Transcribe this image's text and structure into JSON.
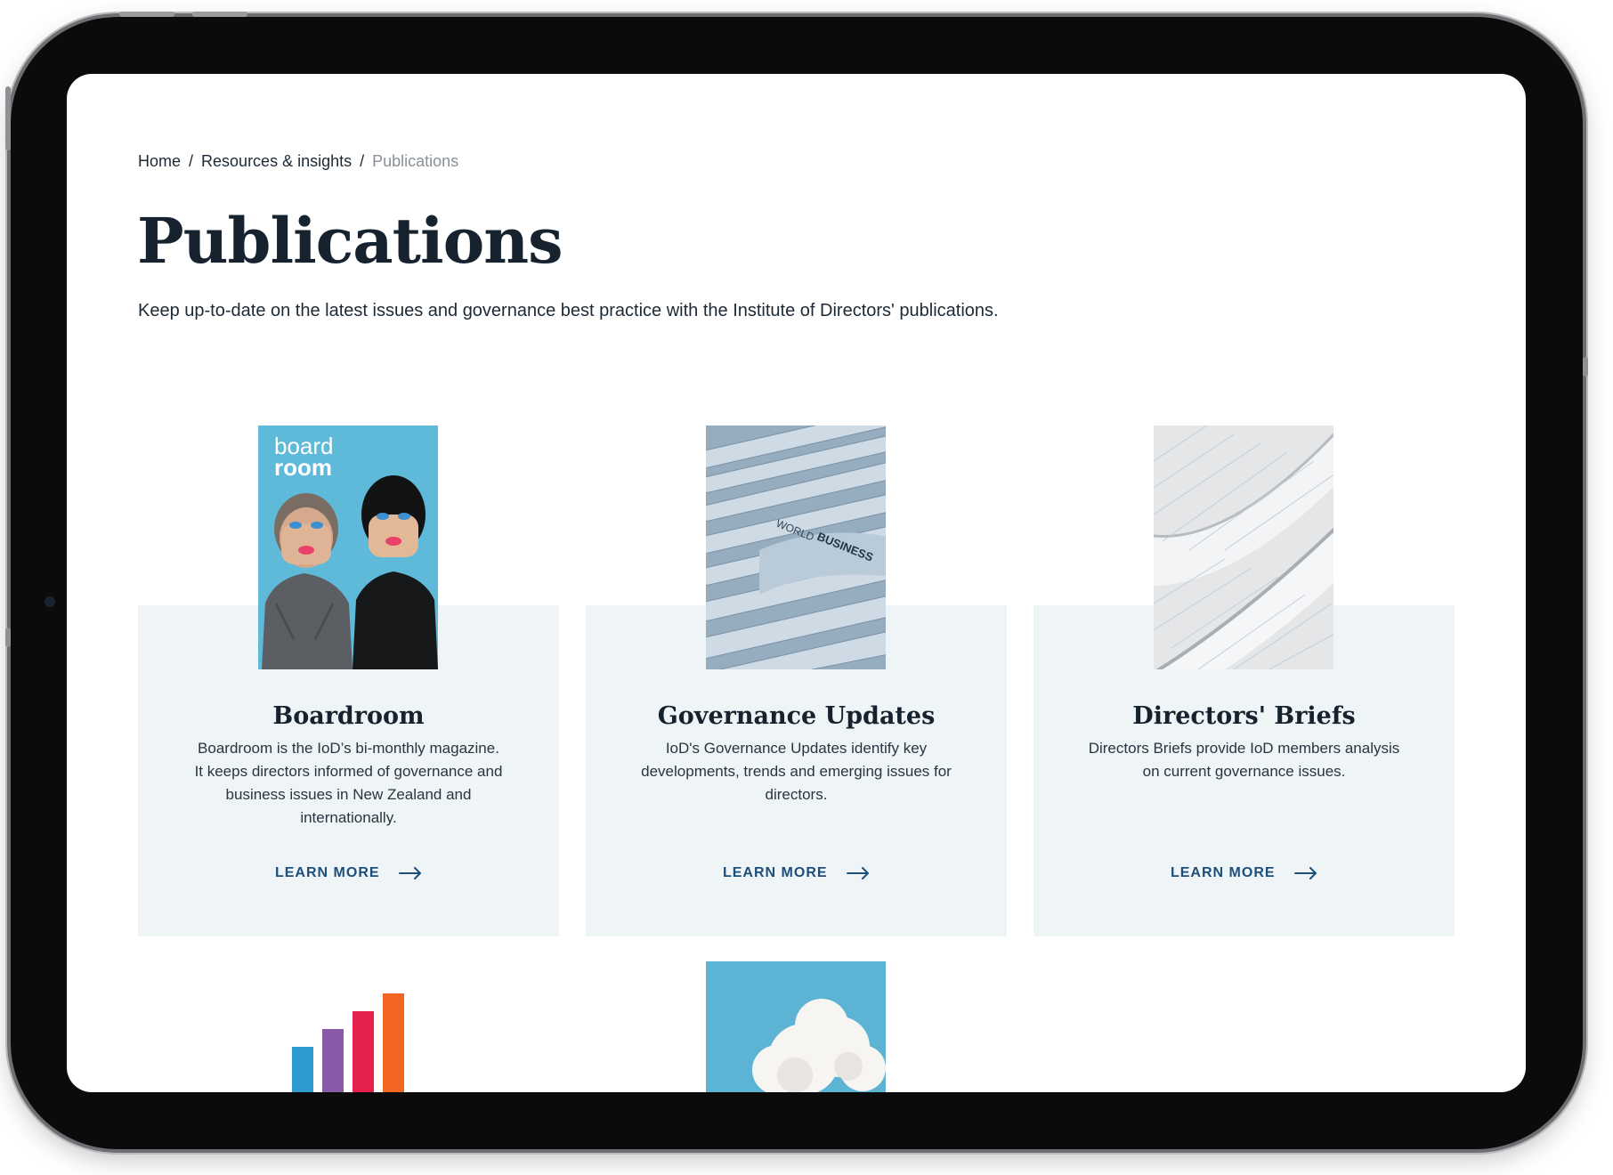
{
  "breadcrumb": {
    "items": [
      "Home",
      "Resources & insights"
    ],
    "separator": "/",
    "current": "Publications"
  },
  "page": {
    "title": "Publications",
    "intro": "Keep up-to-date on the latest issues and governance best practice with the Institute of Directors' publications."
  },
  "cards": [
    {
      "title": "Boardroom",
      "description": "Boardroom is the IoD’s bi-monthly magazine. It keeps directors informed of governance and business issues in New Zealand and internationally.",
      "cta": "LEARN MORE",
      "image": "boardroom-magazine-cover",
      "cover_text": {
        "line1": "board",
        "line2": "room"
      }
    },
    {
      "title": "Governance Updates",
      "description": "IoD's Governance Updates identify key developments, trends and emerging issues for directors.",
      "cta": "LEARN MORE",
      "image": "newspapers-photo",
      "image_text": [
        "WORLD",
        "BUSINESS"
      ]
    },
    {
      "title": "Directors' Briefs",
      "description": "Directors Briefs provide IoD members analysis on current governance issues.",
      "cta": "LEARN MORE",
      "image": "white-feathers-photo"
    }
  ],
  "lower_thumbs": [
    {
      "image": "bar-chart-graphic",
      "bar_colors": [
        "#2e9bd0",
        "#8a5aa8",
        "#e3204e",
        "#f26522"
      ]
    },
    {
      "image": "cloud-on-blue-photo"
    }
  ],
  "colors": {
    "accent_link": "#1c4f7c",
    "card_background": "#eff4f7",
    "heading": "#16222e",
    "muted": "#8a9097",
    "boardroom_blue": "#5fb9d8"
  },
  "icons": {
    "cta_arrow": "arrow-right-icon"
  }
}
